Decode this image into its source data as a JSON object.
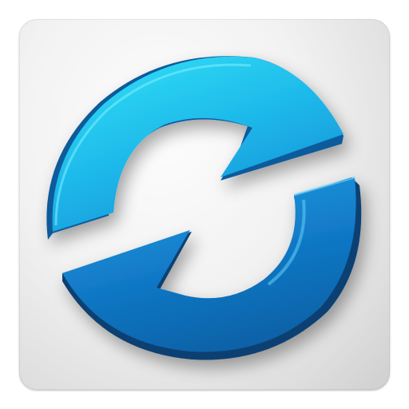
{
  "app_icon": {
    "icon": "sync-arrows-icon",
    "colors": {
      "tile_light": "#fdfdfd",
      "tile_dark": "#cfcfcf",
      "arrow_light": "#2cd9f3",
      "arrow_mid": "#14a8e2",
      "arrow_dark": "#0b5fa3",
      "arrow_edge": "#063f74"
    }
  }
}
